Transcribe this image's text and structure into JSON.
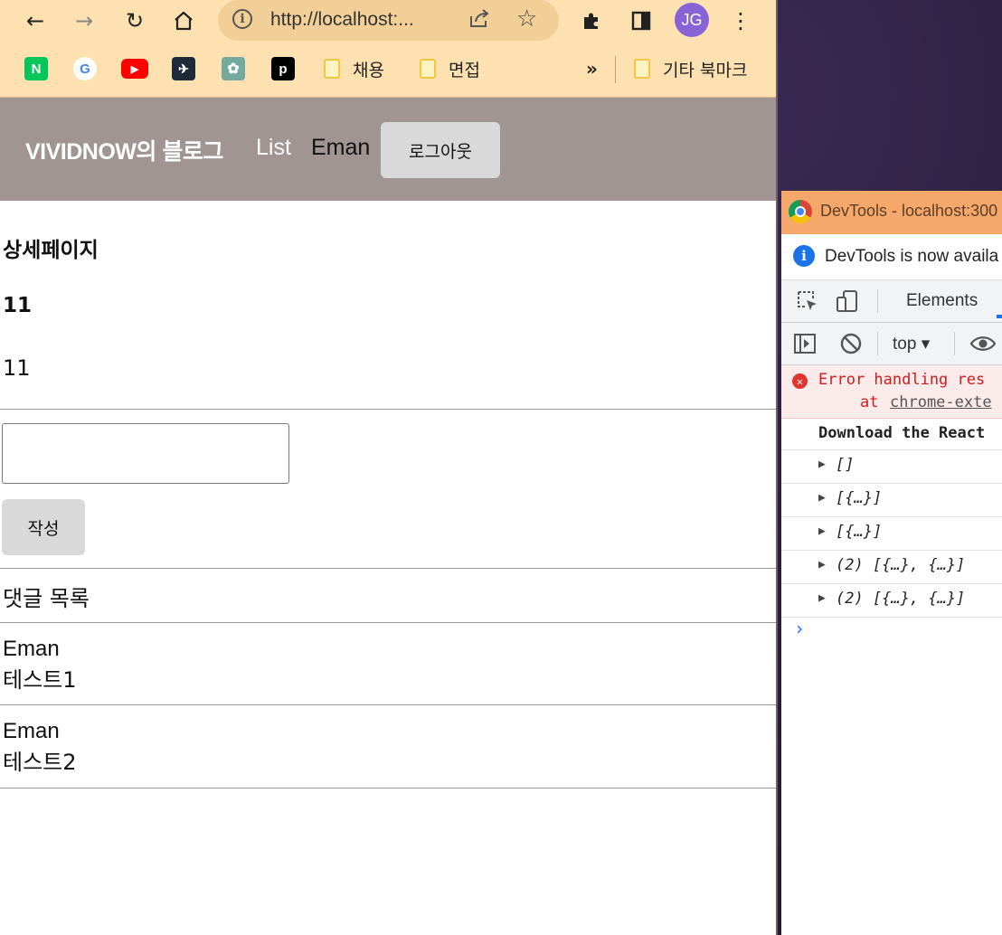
{
  "browser": {
    "url": "http://localhost:...",
    "profile_initials": "JG",
    "bookmarks": [
      {
        "label": "채용"
      },
      {
        "label": "면접"
      }
    ],
    "bookmarks_overflow": "»",
    "other_bookmarks_label": "기타 북마크"
  },
  "navbar": {
    "brand": "VIVIDNOW의 블로그",
    "list_link": "List",
    "username": "Eman",
    "logout_label": "로그아웃"
  },
  "detail": {
    "heading": "상세페이지",
    "post_title": "11",
    "post_content": "11"
  },
  "comment_form": {
    "input_value": "",
    "submit_label": "작성"
  },
  "comments": {
    "label": "댓글 목록",
    "items": [
      {
        "author": "Eman",
        "text": "테스트1"
      },
      {
        "author": "Eman",
        "text": "테스트2"
      }
    ]
  },
  "devtools": {
    "window_title": "DevTools - localhost:300",
    "info_message": "DevTools is now availa",
    "tab_elements": "Elements",
    "context": "top",
    "error_line1": "Error handling res",
    "error_line2_prefix": "at",
    "error_line2_link": "chrome-exte",
    "download_msg": "Download the React",
    "logs": [
      "[]",
      "[{…}]",
      "[{…}]",
      "(2) [{…}, {…}]",
      "(2) [{…}, {…}]"
    ],
    "prompt": "›"
  }
}
